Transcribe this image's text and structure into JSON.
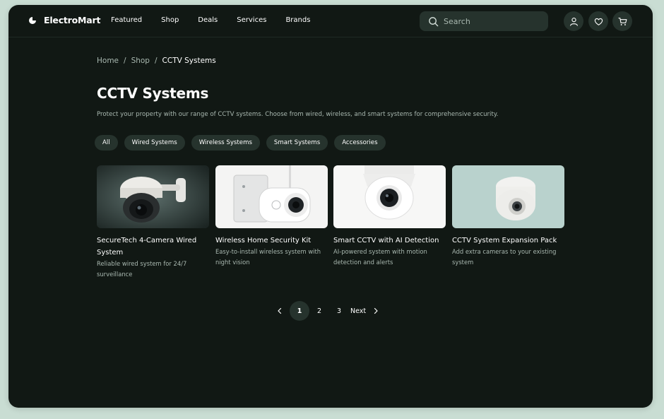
{
  "brand": {
    "name": "ElectroMart"
  },
  "nav": [
    {
      "label": "Featured"
    },
    {
      "label": "Shop"
    },
    {
      "label": "Deals"
    },
    {
      "label": "Services"
    },
    {
      "label": "Brands"
    }
  ],
  "search": {
    "placeholder": "Search",
    "icon": "search-icon"
  },
  "header_icons": [
    "user-icon",
    "heart-icon",
    "cart-icon"
  ],
  "breadcrumb": {
    "home": "Home",
    "shop": "Shop",
    "current": "CCTV Systems",
    "separator": "/"
  },
  "page": {
    "title": "CCTV Systems",
    "subtitle": "Protect your property with our range of CCTV systems. Choose from wired, wireless, and smart systems for comprehensive security."
  },
  "filters": [
    {
      "label": "All"
    },
    {
      "label": "Wired Systems"
    },
    {
      "label": "Wireless Systems"
    },
    {
      "label": "Smart Systems"
    },
    {
      "label": "Accessories"
    }
  ],
  "products": [
    {
      "title": "SecureTech 4-Camera Wired System",
      "description": "Reliable wired system for 24/7 surveillance"
    },
    {
      "title": "Wireless Home Security Kit",
      "description": "Easy-to-install wireless system with night vision"
    },
    {
      "title": "Smart CCTV with AI Detection",
      "description": "AI-powered system with motion detection and alerts"
    },
    {
      "title": "CCTV System Expansion Pack",
      "description": "Add extra cameras to your existing system"
    }
  ],
  "pagination": {
    "pages": [
      "1",
      "2",
      "3"
    ],
    "current": "1",
    "next_label": "Next"
  },
  "colors": {
    "background": "#111814",
    "surface": "#26332d",
    "text": "#ffffff",
    "muted_text": "#a9b8b0",
    "outer": "#c9ddd3"
  }
}
